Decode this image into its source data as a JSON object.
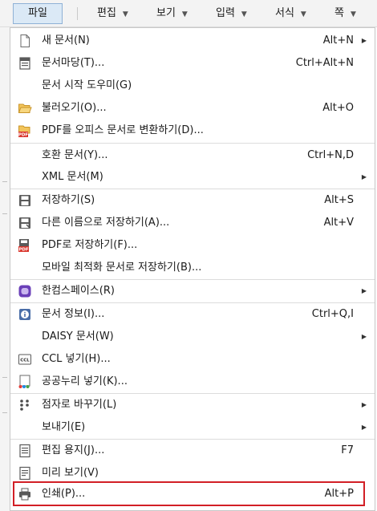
{
  "menubar": {
    "file": "파일",
    "edit": "편집",
    "view": "보기",
    "input": "입력",
    "format": "서식",
    "page": "쪽"
  },
  "menu": {
    "new": {
      "label": "새 문서(N)",
      "shortcut": "Alt+N"
    },
    "template": {
      "label": "문서마당(T)...",
      "shortcut": "Ctrl+Alt+N"
    },
    "wizard": {
      "label": "문서 시작 도우미(G)"
    },
    "open": {
      "label": "불러오기(O)...",
      "shortcut": "Alt+O"
    },
    "pdf_convert": {
      "label": "PDF를 오피스 문서로 변환하기(D)..."
    },
    "compat": {
      "label": "호환 문서(Y)...",
      "shortcut": "Ctrl+N,D"
    },
    "xml": {
      "label": "XML 문서(M)"
    },
    "save": {
      "label": "저장하기(S)",
      "shortcut": "Alt+S"
    },
    "save_as": {
      "label": "다른 이름으로 저장하기(A)...",
      "shortcut": "Alt+V"
    },
    "save_pdf": {
      "label": "PDF로 저장하기(F)..."
    },
    "save_mobile": {
      "label": "모바일 최적화 문서로 저장하기(B)..."
    },
    "hancom_space": {
      "label": "한컴스페이스(R)"
    },
    "doc_info": {
      "label": "문서 정보(I)...",
      "shortcut": "Ctrl+Q,I"
    },
    "daisy": {
      "label": "DAISY 문서(W)"
    },
    "ccl": {
      "label": "CCL 넣기(H)..."
    },
    "public": {
      "label": "공공누리 넣기(K)..."
    },
    "braille": {
      "label": "점자로 바꾸기(L)"
    },
    "send": {
      "label": "보내기(E)"
    },
    "paper": {
      "label": "편집 용지(J)...",
      "shortcut": "F7"
    },
    "preview": {
      "label": "미리 보기(V)"
    },
    "print": {
      "label": "인쇄(P)...",
      "shortcut": "Alt+P"
    }
  },
  "colors": {
    "highlight_border": "#d21f26",
    "file_tab_bg": "#dbe9f6"
  }
}
